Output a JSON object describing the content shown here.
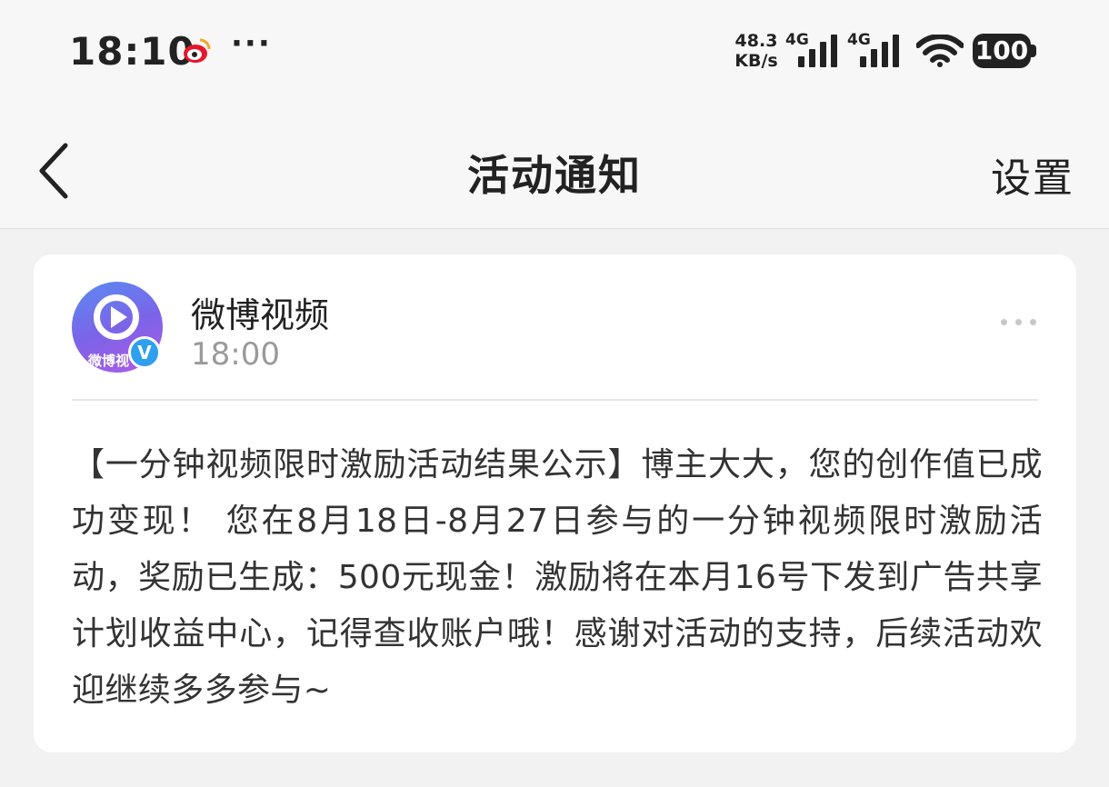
{
  "status_bar": {
    "time": "18:10",
    "more_label": "···",
    "net_speed_value": "48.3",
    "net_speed_unit": "KB/s",
    "signal_1_gen": "4G",
    "signal_2_gen": "4G",
    "battery_level": "100",
    "icons": [
      "weibo-icon",
      "wifi-icon",
      "signal-icon",
      "battery-icon"
    ]
  },
  "nav": {
    "title": "活动通知",
    "settings_label": "设置",
    "back_icon": "chevron-left-icon"
  },
  "notification": {
    "sender_name": "微博视频",
    "avatar_text": "微博视",
    "verified_mark": "V",
    "time": "18:00",
    "more_icon": "more-horizontal-icon",
    "message": "【一分钟视频限时激励活动结果公示】博主大大，您的创作值已成功变现！ 您在8月18日-8月27日参与的一分钟视频限时激励活动，奖励已生成：500元现金！激励将在本月16号下发到广告共享计划收益中心，记得查收账户哦！感谢对活动的支持，后续活动欢迎继续多多参与~"
  },
  "colors": {
    "accent_blue": "#2f9ff0",
    "avatar_gradient_start": "#5a8cf3",
    "avatar_gradient_end": "#b05ae6"
  }
}
